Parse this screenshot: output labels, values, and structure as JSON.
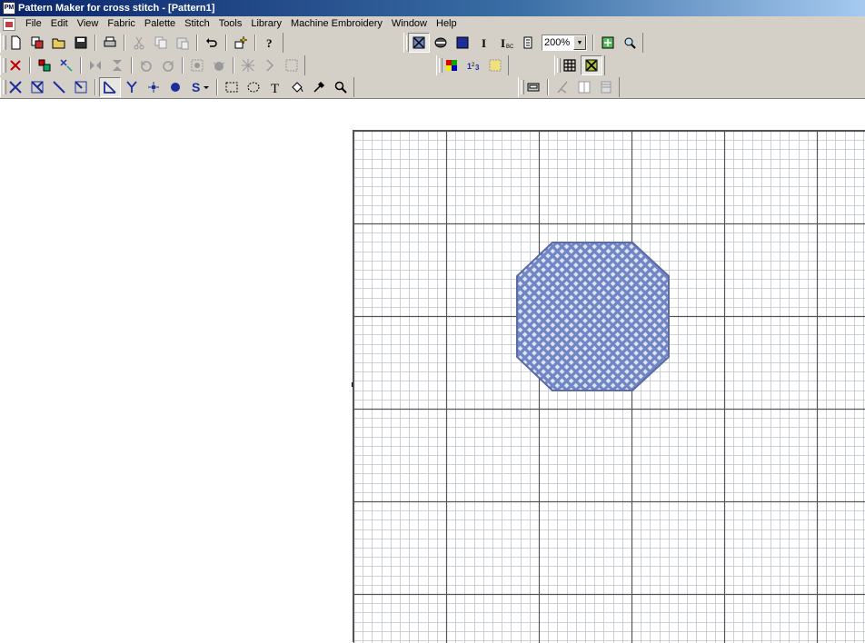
{
  "window": {
    "title": "Pattern Maker for cross stitch - [Pattern1]",
    "app_icon_text": "PM"
  },
  "menu": [
    "File",
    "Edit",
    "View",
    "Fabric",
    "Palette",
    "Stitch",
    "Tools",
    "Library",
    "Machine Embroidery",
    "Window",
    "Help"
  ],
  "toolbar": {
    "zoom_value": "200%"
  },
  "colors": {
    "stitch_fill": "#7b8fc7",
    "stitch_outline": "#5a6ba5",
    "grid_minor": "#bfc3cc",
    "grid_major": "#555555"
  },
  "canvas": {
    "marker_top_icon": "arrow-down-marker-icon",
    "marker_left_icon": "arrow-right-marker-icon"
  }
}
